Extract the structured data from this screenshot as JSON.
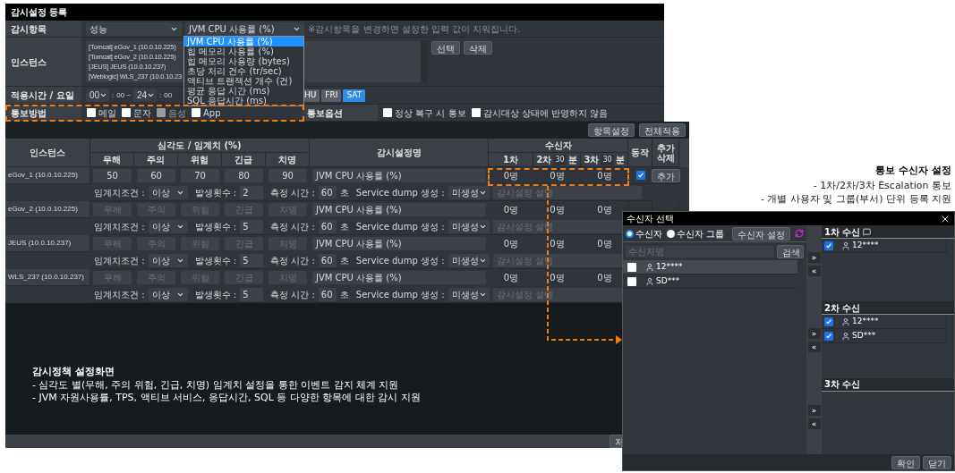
{
  "window": {
    "title": "감시설정 등록"
  },
  "monitor_item": {
    "label": "감시항목",
    "category": "성능",
    "metric": "JVM CPU 사용률 (%)",
    "note": "※감시항목을 변경하면 설정한 입력 값이 지워집니다.",
    "options": [
      {
        "label": "JVM CPU 사용률 (%)",
        "selected": true
      },
      {
        "label": "힙 메모리 사용률 (%)",
        "selected": false
      },
      {
        "label": "힙 메모리 사용량 (bytes)",
        "selected": false
      },
      {
        "label": "초당 처리 건수 (tr/sec)",
        "selected": false
      },
      {
        "label": "액티브 트랜잭션 개수 (건)",
        "selected": false
      },
      {
        "label": "평균 응답 시간 (ms)",
        "selected": false
      },
      {
        "label": "SQL 응답시간 (ms)",
        "selected": false
      }
    ]
  },
  "instances": {
    "label": "인스턴스",
    "items": [
      "[Tomcat] eGov_1 (10.0.10.225)",
      "[Tomcat] eGov_2 (10.0.10.225)",
      "[JEUS] JEUS (10.0.10.237)",
      "[Weblogic] WLS_237 (10.0.10.23"
    ],
    "buttons": [
      "선택",
      "삭제"
    ]
  },
  "schedule": {
    "label": "적용시간 / 요일",
    "time_parts": [
      {
        "kind": "select",
        "value": "00"
      },
      {
        "kind": "text",
        "value": ":"
      },
      {
        "kind": "text",
        "value": "00 ~"
      },
      {
        "kind": "select",
        "value": "24"
      },
      {
        "kind": "text",
        "value": ":"
      },
      {
        "kind": "text",
        "value": "00"
      }
    ],
    "days": [
      {
        "label": "HU",
        "selected": false
      },
      {
        "label": "FRI",
        "selected": false
      },
      {
        "label": "SAT",
        "selected": true
      }
    ]
  },
  "notify": {
    "label": "통보방법",
    "methods": [
      {
        "label": "메일",
        "checked": false,
        "disabled": false
      },
      {
        "label": "문자",
        "checked": false,
        "disabled": false
      },
      {
        "label": "음성",
        "checked": false,
        "disabled": true
      },
      {
        "label": "App",
        "checked": false,
        "disabled": false
      }
    ],
    "options_label": "통보옵션",
    "options": [
      {
        "label": "정상 복구 시 통보",
        "checked": false
      },
      {
        "label": "감시대상 상태에 반영하지 않음",
        "checked": false
      }
    ]
  },
  "toolbar": {
    "buttons": [
      "항목설정",
      "전체적용"
    ]
  },
  "table": {
    "header": {
      "instance": "인스턴스",
      "severity_group": "심각도 / 임계치 (%)",
      "severities": [
        "무해",
        "주의",
        "위험",
        "긴급",
        "치명"
      ],
      "name": "감시설정명",
      "recipients": "수신자",
      "first": "1차",
      "second": "2차",
      "second_minutes": "30",
      "second_unit": "분",
      "third": "3차",
      "third_minutes": "30",
      "third_unit": "분",
      "action": "동작",
      "add_delete": "추가 삭제"
    },
    "rows": [
      {
        "instance": "eGov_1 (10.0.10.225)",
        "thresholds": [
          {
            "value": "50"
          },
          {
            "value": "60"
          },
          {
            "value": "70"
          },
          {
            "value": "80"
          },
          {
            "value": "90"
          }
        ],
        "condition_label": "임계치조건 :",
        "condition": "이상",
        "count_label": "발생횟수 :",
        "count": "2",
        "time_label": "측정 시간 :",
        "time": "60",
        "time_unit": "초",
        "name": "JVM CPU 사용률 (%)",
        "dump_label": "Service dump 생성 :",
        "dump": "미생성",
        "description_placeholder": "감시설정 설명",
        "recipients": [
          "0명",
          "0명",
          "0명"
        ],
        "action": {
          "checked": true,
          "button": "추가"
        }
      },
      {
        "instance": "eGov_2 (10.0.10.225)",
        "thresholds": [
          {
            "placeholder": "무해"
          },
          {
            "placeholder": "주의"
          },
          {
            "placeholder": "위험"
          },
          {
            "placeholder": "긴급"
          },
          {
            "placeholder": "치명"
          }
        ],
        "condition_label": "임계치조건 :",
        "condition": "이상",
        "count_label": "발생횟수 :",
        "count": "5",
        "time_label": "측정 시간 :",
        "time": "60",
        "time_unit": "초",
        "name": "JVM CPU 사용률 (%)",
        "dump_label": "Service dump 생성 :",
        "dump": "미생성",
        "description_placeholder": "감시설정 설명",
        "recipients": [
          "0명",
          "0명",
          "0명"
        ]
      },
      {
        "instance": "JEUS (10.0.10.237)",
        "thresholds": [
          {
            "placeholder": "무해"
          },
          {
            "placeholder": "주의"
          },
          {
            "placeholder": "위험"
          },
          {
            "placeholder": "긴급"
          },
          {
            "placeholder": "치명"
          }
        ],
        "condition_label": "임계치조건 :",
        "condition": "이상",
        "count_label": "발생횟수 :",
        "count": "5",
        "time_label": "측정 시간 :",
        "time": "60",
        "time_unit": "초",
        "name": "JVM CPU 사용률 (%)",
        "dump_label": "Service dump 생성 :",
        "dump": "미생성",
        "description_placeholder": "감시설정 설명",
        "recipients": [
          "0명",
          "0명",
          "0명"
        ]
      },
      {
        "instance": "WLS_237 (10.0.10.237)",
        "thresholds": [
          {
            "placeholder": "무해"
          },
          {
            "placeholder": "주의"
          },
          {
            "placeholder": "위험"
          },
          {
            "placeholder": "긴급"
          },
          {
            "placeholder": "치명"
          }
        ],
        "condition_label": "임계치조건 :",
        "condition": "이상",
        "count_label": "발생횟수 :",
        "count": "5",
        "time_label": "측정 시간 :",
        "time": "60",
        "time_unit": "초",
        "name": "JVM CPU 사용률 (%)",
        "dump_label": "Service dump 생성 :",
        "dump": "미생성",
        "description_placeholder": "감시설정 설명",
        "recipients": [
          "0명",
          "0명",
          "0명"
        ]
      }
    ]
  },
  "footer_buttons": [
    "저"
  ],
  "left_annotation": {
    "title": "감시정책 설정화면",
    "lines": [
      "- 심각도 별(무해, 주의 위험, 긴급, 치명) 임계치 설정을 통한 이벤트 감지 체계 지원",
      "- JVM 자원사용률, TPS, 액티브 서비스, 응답시간, SQL 등 다양한 항목에 대한 감시 지원"
    ]
  },
  "right_annotation": {
    "title": "통보 수신자 설정",
    "lines": [
      "- 1차/2차/3차 Escalation 통보",
      "- 개별 사용자 및 그룹(부서) 단위 등록 지원"
    ]
  },
  "dialog": {
    "title": "수신자 선택",
    "radios": [
      {
        "label": "수신자",
        "selected": true
      },
      {
        "label": "수신자 그룹",
        "selected": false
      }
    ],
    "settings_button": "수신자 설정",
    "search_placeholder": "수신자명",
    "search_button": "검색",
    "users": [
      {
        "name": "12****",
        "checked": false
      },
      {
        "name": "SD***",
        "checked": false
      }
    ],
    "move_right": "»",
    "move_left": "«",
    "sections": [
      {
        "title": "1차 수신",
        "users": [
          {
            "name": "12****",
            "checked": true
          }
        ]
      },
      {
        "title": "2차 수신",
        "users": [
          {
            "name": "12****",
            "checked": true
          },
          {
            "name": "SD***",
            "checked": true
          }
        ]
      },
      {
        "title": "3차 수신"
      }
    ],
    "buttons": [
      "확인",
      "닫기"
    ]
  }
}
